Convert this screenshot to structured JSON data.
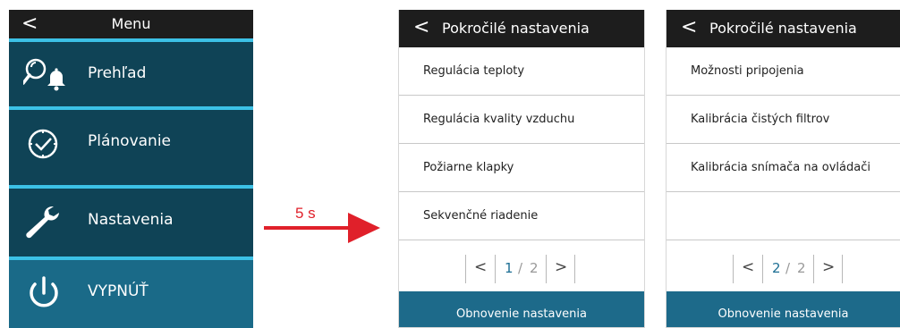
{
  "menu": {
    "back_glyph": "<",
    "title": "Menu",
    "items": [
      {
        "label": "Prehľad",
        "icon": "search-bell-icon"
      },
      {
        "label": "Plánovanie",
        "icon": "clock-check-icon"
      },
      {
        "label": "Nastavenia",
        "icon": "wrench-icon"
      },
      {
        "label": "VYPNÚŤ",
        "icon": "power-icon"
      }
    ]
  },
  "transition": {
    "label": "5 s"
  },
  "screens": [
    {
      "title": "Pokročilé nastavenia",
      "rows": [
        "Regulácia teploty",
        "Regulácia kvality vzduchu",
        "Požiarne klapky",
        "Sekvenčné riadenie"
      ],
      "page_current": "1",
      "page_sep": "/",
      "page_total": "2",
      "footer": "Obnovenie nastavenia"
    },
    {
      "title": "Pokročilé nastavenia",
      "rows": [
        "Možnosti pripojenia",
        "Kalibrácia čistých filtrov",
        "Kalibrácia snímača na ovládači",
        ""
      ],
      "page_current": "2",
      "page_sep": "/",
      "page_total": "2",
      "footer": "Obnovenie nastavenia"
    }
  ],
  "colors": {
    "header": "#1d1d1d",
    "menu_bg": "#0f4356",
    "menu_off_bg": "#1a6a88",
    "separator": "#3cc1e6",
    "footer": "#1d6a8a",
    "arrow": "#e0202a",
    "page_active": "#1d6f94"
  }
}
